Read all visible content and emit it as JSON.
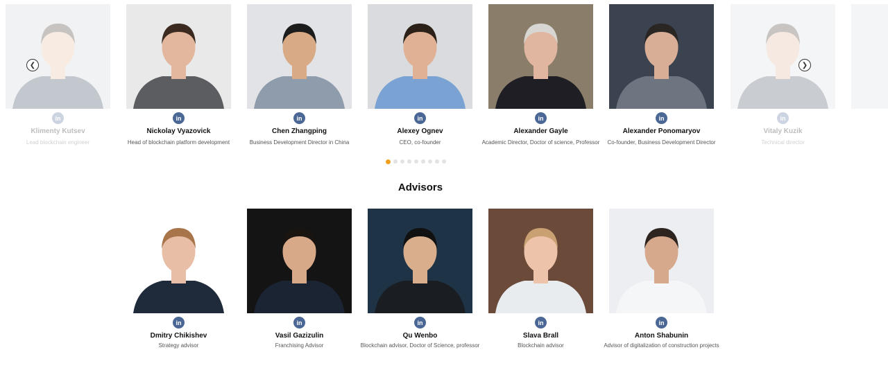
{
  "team": {
    "linkedin_label": "in",
    "prev_icon": "chevron-left-icon",
    "next_icon": "chevron-right-icon",
    "carousel_page": 1,
    "carousel_pages": 9,
    "members": [
      {
        "name": "Klimenty Kutsev",
        "role": "Lead blockchain engineer",
        "bg": "#cfd3d8",
        "shirt": "#2b3d55",
        "skin": "#e3b99b",
        "hair": "#3a2c22"
      },
      {
        "name": "Nickolay Vyazovick",
        "role": "Head of blockchain platform development",
        "bg": "#e9e9e9",
        "shirt": "#5b5d61",
        "skin": "#e2b79d",
        "hair": "#3c2a20"
      },
      {
        "name": "Chen Zhangping",
        "role": "Business Development Director in China",
        "bg": "#e1e3e6",
        "shirt": "#8f9cab",
        "skin": "#d8aa85",
        "hair": "#1d1c1c"
      },
      {
        "name": "Alexey Ognev",
        "role": "CEO, co-founder",
        "bg": "#d9dbde",
        "shirt": "#7aa3d4",
        "skin": "#e1b196",
        "hair": "#2b2119"
      },
      {
        "name": "Alexander Gayle",
        "role": "Academic Director, Doctor of science, Professor",
        "bg": "#8a7e6a",
        "shirt": "#1e1e24",
        "skin": "#e0b6a0",
        "hair": "#d8d6d2"
      },
      {
        "name": "Alexander Ponomaryov",
        "role": "Co-founder, Business Development Director",
        "bg": "#3b4350",
        "shirt": "#6e7480",
        "skin": "#d8ae96",
        "hair": "#2a2624"
      },
      {
        "name": "Vitaly Kuzik",
        "role": "Technical director",
        "bg": "#d8dce2",
        "shirt": "#3f4a5e",
        "skin": "#ddb397",
        "hair": "#3b2f26"
      }
    ]
  },
  "advisors": {
    "title": "Advisors",
    "members": [
      {
        "name": "Dmitry Chikishev",
        "role": "Strategy advisor",
        "bg": "#ffffff",
        "shirt": "#1f2a3a",
        "skin": "#e8bfa6",
        "hair": "#a8744a"
      },
      {
        "name": "Vasil Gazizulin",
        "role": "Franchising Advisor",
        "bg": "#141414",
        "shirt": "#1b2433",
        "skin": "#d8a988",
        "hair": "#1a1410"
      },
      {
        "name": "Qu Wenbo",
        "role": "Blockchain advisor, Doctor of Science, professor",
        "bg": "#1f3346",
        "shirt": "#1a1d22",
        "skin": "#d8ae8c",
        "hair": "#111111"
      },
      {
        "name": "Slava Brall",
        "role": "Blockchain advisor",
        "bg": "#6b4a3a",
        "shirt": "#e9ecef",
        "skin": "#edc3aa",
        "hair": "#c9a071"
      },
      {
        "name": "Anton Shabunin",
        "role": "Advisor of digitalization of construction projects",
        "bg": "#eceef1",
        "shirt": "#f5f6f8",
        "skin": "#d7a98c",
        "hair": "#2d2420"
      }
    ]
  }
}
